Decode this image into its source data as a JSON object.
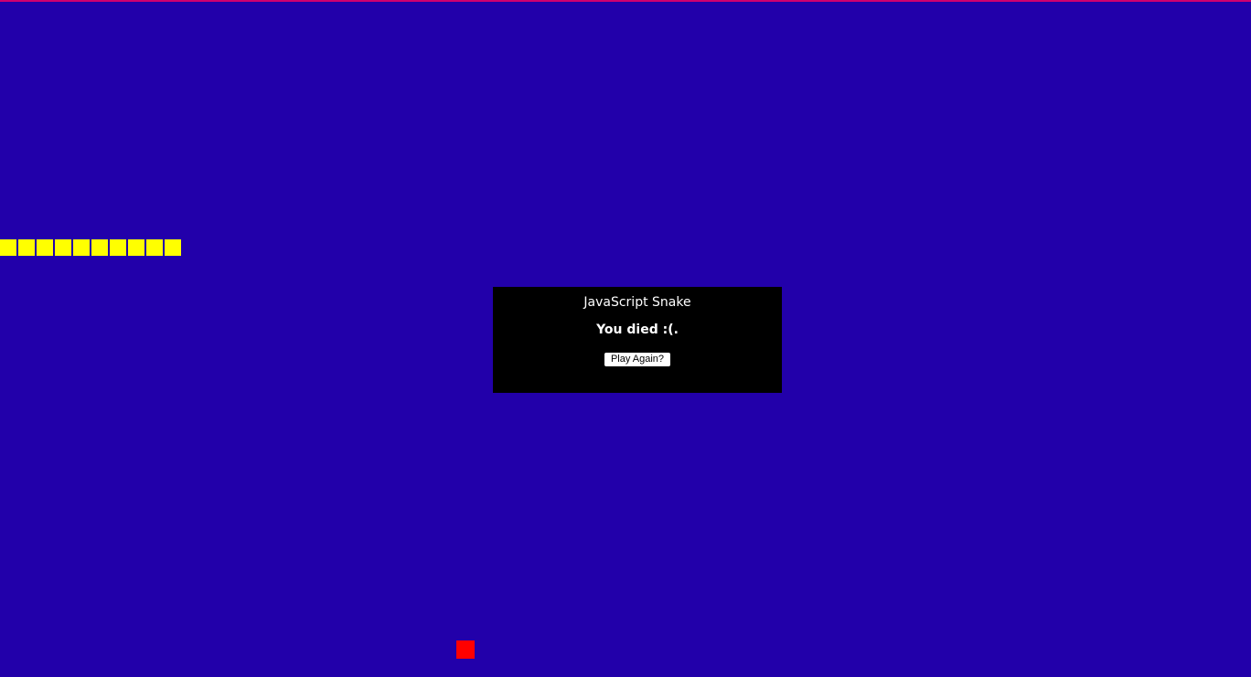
{
  "game": {
    "colors": {
      "background": "#2200AA",
      "top_border": "#D0006F",
      "snake": "#FFFF00",
      "food": "#FF0000",
      "dialog_background": "#000000",
      "dialog_text": "#FFFFFF"
    },
    "snake_segment_count": 10
  },
  "dialog": {
    "title": "JavaScript Snake",
    "message": "You died :(.",
    "button_label": "Play Again?"
  }
}
